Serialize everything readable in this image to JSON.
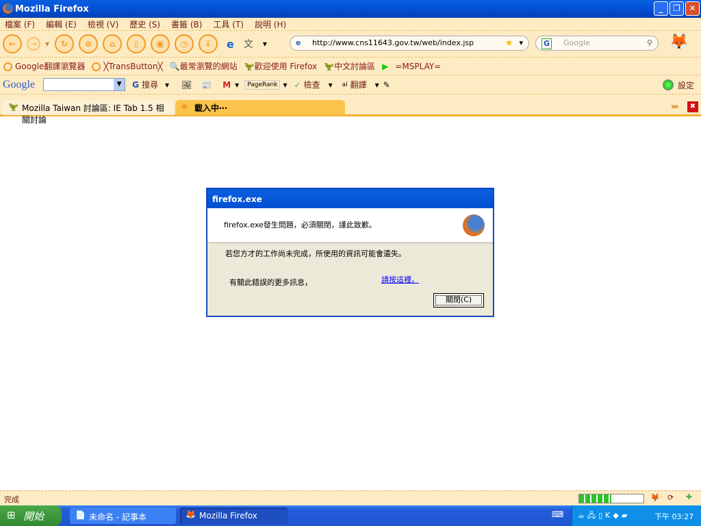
{
  "window": {
    "title": "Mozilla Firefox"
  },
  "menu": [
    "檔案 (F)",
    "編輯 (E)",
    "檢視 (V)",
    "歷史 (S)",
    "書籤 (B)",
    "工具 (T)",
    "說明 (H)"
  ],
  "address": {
    "url": "http://www.cns11643.gov.tw/web/index.jsp"
  },
  "search": {
    "placeholder": "Google"
  },
  "bookmarks": [
    "Google翻譯瀏覽器",
    "╳TransButton╳",
    "最常瀏覽的網站",
    "歡迎使用 Firefox",
    "中文討論區",
    "=MSPLAY="
  ],
  "google_toolbar": {
    "logo": "Google",
    "search": "搜尋",
    "pagerank": "PageRank",
    "check": "檢查",
    "translate": "翻譯",
    "settings": "設定"
  },
  "tabs": [
    {
      "label": "Mozilla Taiwan 討論區: IE Tab 1.5 相關討論"
    },
    {
      "label": "載入中⋯"
    }
  ],
  "dialog": {
    "title": "firefox.exe",
    "message": "firefox.exe發生問題，必須關閉，謹此致歉。",
    "info": "若您方才的工作尚未完成，所使用的資訊可能會遺失。",
    "more": "有關此錯誤的更多訊息，",
    "link": "請按這裡。",
    "close": "關閉(C)"
  },
  "status": {
    "text": "完成",
    "progress_percent": 50
  },
  "taskbar": {
    "start": "開始",
    "items": [
      "未命名 - 記事本",
      "Mozilla Firefox"
    ],
    "clock": "下午 03:27"
  }
}
